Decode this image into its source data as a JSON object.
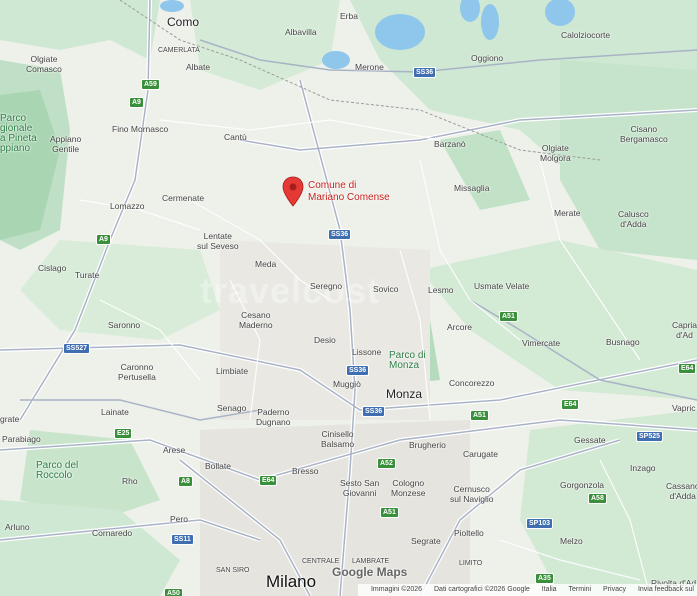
{
  "map": {
    "pin": {
      "label_line1": "Comune di",
      "label_line2": "Mariano Comense"
    },
    "brand": "Google Maps",
    "watermark": "travelcost",
    "attribution": {
      "imagery": "Immagini ©2026",
      "data": "Dati cartografici ©2026 Google",
      "country": "Italia",
      "terms": "Termini",
      "privacy": "Privacy",
      "feedback": "Invia feedback sul"
    },
    "places": {
      "como": "Como",
      "erba": "Erba",
      "albavilla": "Albavilla",
      "caloziocorte": "Calolziocorte",
      "camerlata": "CAMERLATA",
      "olgiate_comasco": "Olgiate\nComasco",
      "albate": "Albate",
      "merone": "Merone",
      "oggiono": "Oggiono",
      "parco_regionale": "Parco\ngionale\na Pineta\nppiano",
      "appiano_gentile": "Appiano\nGentile",
      "fino_mornasco": "Fino Mornasco",
      "cantu": "Cantù",
      "barzano": "Barzanò",
      "olgiate_molgora": "Olgiate\nMolgora",
      "cisano_bergamasco": "Cisano\nBergamasco",
      "cermenate": "Cermenate",
      "missaglia": "Missaglia",
      "lomazzo": "Lomazzo",
      "merate": "Merate",
      "calusco": "Calusco\nd'Adda",
      "lentate": "Lentate\nsul Seveso",
      "meda": "Meda",
      "cislago": "Cislago",
      "turate": "Turate",
      "seregno": "Seregno",
      "sovico": "Sovico",
      "lesmo": "Lesmo",
      "usmate": "Usmate Velate",
      "saronno": "Saronno",
      "cesano": "Cesano\nMaderno",
      "arcore": "Arcore",
      "capriate": "Capria\nd'Ad",
      "caronno": "Caronno\nPertusella",
      "desio": "Desio",
      "lissone": "Lissone",
      "parco_monza": "Parco di\nMonza",
      "vimercate": "Vimercate",
      "busnago": "Busnago",
      "limbiate": "Limbiate",
      "muggio": "Muggiò",
      "concorezzo": "Concorezzo",
      "monza": "Monza",
      "grate": "grate",
      "lainate": "Lainate",
      "senago": "Senago",
      "paderno": "Paderno\nDugnano",
      "vaprio": "Vapric",
      "parabiago": "Parabiago",
      "cinisello": "Cinisello\nBalsamo",
      "brugherio": "Brugherio",
      "gessate": "Gessate",
      "arese": "Arese",
      "carugate": "Carugate",
      "parco_roccolo": "Parco del\nRoccolo",
      "bollate": "Bollate",
      "bresso": "Bresso",
      "inzago": "Inzago",
      "rho": "Rho",
      "sesto": "Sesto San\nGiovanni",
      "cologno": "Cologno\nMonzese",
      "cernusco": "Cernusco\nsul Naviglio",
      "gorgonzola": "Gorgonzola",
      "cassano": "Cassano\nd'Adda",
      "arluno": "Arluno",
      "pero": "Pero",
      "cornaredo": "Cornaredo",
      "segrate": "Segrate",
      "pioltello": "Pioltello",
      "melzo": "Melzo",
      "centrale": "CENTRALE",
      "lambrate": "LAMBRATE",
      "limito": "LIMITO",
      "san_siro": "SAN SIRO",
      "milano": "Milano",
      "rivolta": "Rivolta d'Ad"
    },
    "shields": {
      "a9a": "A9",
      "a59": "A59",
      "a9b": "A9",
      "ss36a": "SS36",
      "ss36b": "SS36",
      "ss36c": "SS36",
      "ss36d": "SS36",
      "ss527": "SS527",
      "a51a": "A51",
      "a51b": "A51",
      "a51c": "A51",
      "e64a": "E64",
      "e64b": "E64",
      "e64c": "E64",
      "e25": "E25",
      "a8": "A8",
      "a52": "A52",
      "sp103": "SP103",
      "sp525": "SP525",
      "a58": "A58",
      "ss11": "SS11",
      "a35": "A35",
      "a50": "A50"
    }
  }
}
